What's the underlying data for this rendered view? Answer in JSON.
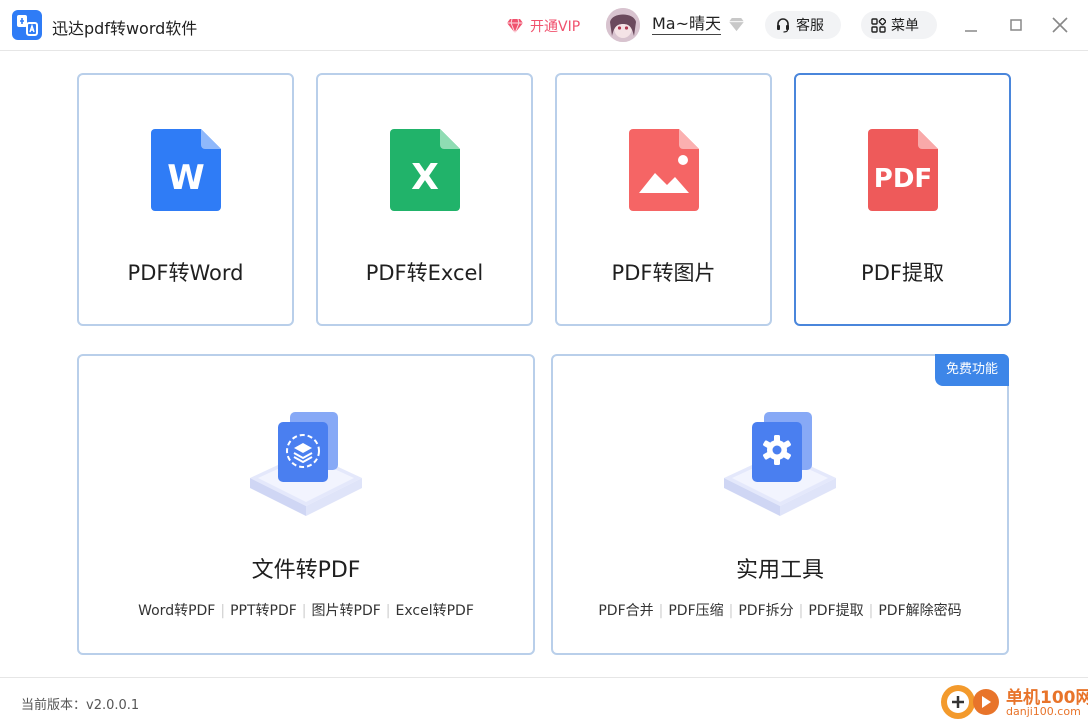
{
  "titlebar": {
    "app_title": "迅达pdf转word软件",
    "vip_label": "开通VIP",
    "username": "Ma~晴天",
    "service_label": "客服",
    "menu_label": "菜单"
  },
  "colors": {
    "accent": "#2f7cf6",
    "vip": "#f0526e",
    "card_border": "#b9cfea",
    "card_border_active": "#4a86db",
    "badge": "#3d86e8"
  },
  "tools": [
    {
      "label": "PDF转Word",
      "icon": "word-file-icon",
      "glyph": "W"
    },
    {
      "label": "PDF转Excel",
      "icon": "excel-file-icon",
      "glyph": "X"
    },
    {
      "label": "PDF转图片",
      "icon": "image-file-icon"
    },
    {
      "label": "PDF提取",
      "icon": "pdf-file-icon",
      "glyph": "PDF",
      "active": true
    }
  ],
  "file_to_pdf": {
    "label": "文件转PDF",
    "icon": "layers-stack-icon",
    "links": [
      "Word转PDF",
      "PPT转PDF",
      "图片转PDF",
      "Excel转PDF"
    ]
  },
  "utilities": {
    "label": "实用工具",
    "icon": "gear-stack-icon",
    "badge": "免费功能",
    "links": [
      "PDF合并",
      "PDF压缩",
      "PDF拆分",
      "PDF提取",
      "PDF解除密码"
    ]
  },
  "statusbar": {
    "version": "当前版本：v2.0.0.1",
    "watermark_name": "单机100网",
    "watermark_url": "danji100.com"
  }
}
